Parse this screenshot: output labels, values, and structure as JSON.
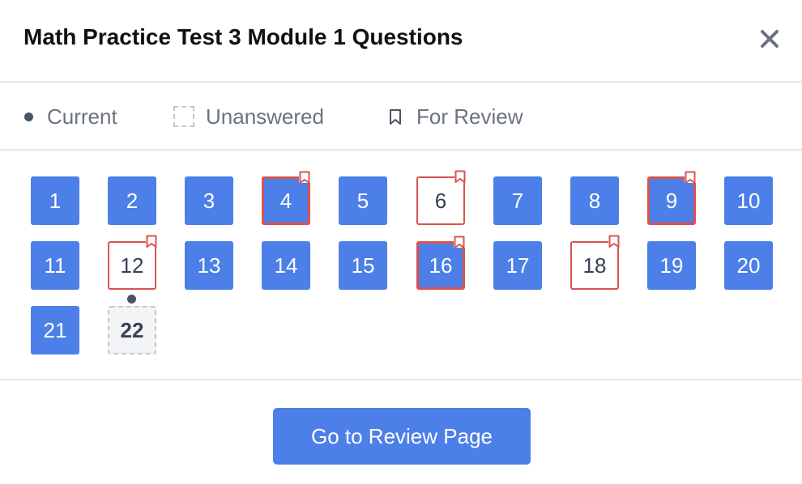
{
  "dialog": {
    "title": "Math Practice Test 3 Module 1 Questions",
    "close_icon": "close-icon"
  },
  "legend": {
    "current": "Current",
    "unanswered": "Unanswered",
    "for_review": "For Review"
  },
  "colors": {
    "answered": "#4d7fe8",
    "review_border": "#d9534f",
    "current_bg": "#f3f4f6"
  },
  "questions": [
    {
      "label": "1",
      "state": "answered",
      "review": false
    },
    {
      "label": "2",
      "state": "answered",
      "review": false
    },
    {
      "label": "3",
      "state": "answered",
      "review": false
    },
    {
      "label": "4",
      "state": "answered",
      "review": true
    },
    {
      "label": "5",
      "state": "answered",
      "review": false
    },
    {
      "label": "6",
      "state": "unanswered",
      "review": true
    },
    {
      "label": "7",
      "state": "answered",
      "review": false
    },
    {
      "label": "8",
      "state": "answered",
      "review": false
    },
    {
      "label": "9",
      "state": "answered",
      "review": true
    },
    {
      "label": "10",
      "state": "answered",
      "review": false
    },
    {
      "label": "11",
      "state": "answered",
      "review": false
    },
    {
      "label": "12",
      "state": "unanswered",
      "review": true
    },
    {
      "label": "13",
      "state": "answered",
      "review": false
    },
    {
      "label": "14",
      "state": "answered",
      "review": false
    },
    {
      "label": "15",
      "state": "answered",
      "review": false
    },
    {
      "label": "16",
      "state": "answered",
      "review": true
    },
    {
      "label": "17",
      "state": "answered",
      "review": false
    },
    {
      "label": "18",
      "state": "unanswered",
      "review": true
    },
    {
      "label": "19",
      "state": "answered",
      "review": false
    },
    {
      "label": "20",
      "state": "answered",
      "review": false
    },
    {
      "label": "21",
      "state": "answered",
      "review": false
    },
    {
      "label": "22",
      "state": "current",
      "review": false
    }
  ],
  "footer": {
    "review_button": "Go to Review Page"
  }
}
